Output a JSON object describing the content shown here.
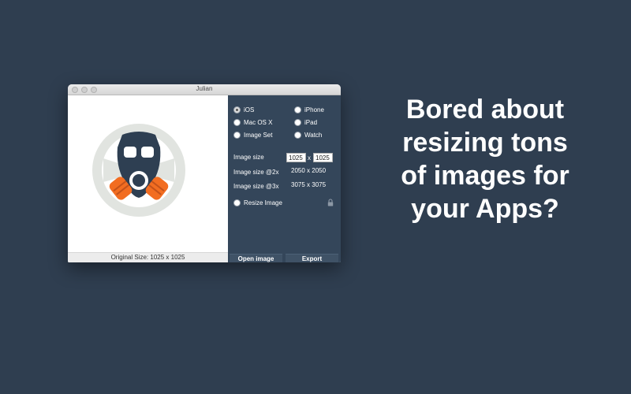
{
  "window": {
    "title": "Julian",
    "original_size_label": "Original Size: 1025 x 1025"
  },
  "platforms": {
    "ios": "iOS",
    "macosx": "Mac OS X",
    "imageset": "Image Set",
    "iphone": "iPhone",
    "ipad": "iPad",
    "watch": "Watch",
    "selected": "iOS"
  },
  "sizes": {
    "image_size_label": "Image size",
    "width_value": "1025",
    "separator": "x",
    "height_value": "1025",
    "size2x_label": "Image size @2x",
    "size2x_value": "2050 x 2050",
    "size3x_label": "Image size @3x",
    "size3x_value": "3075 x 3075"
  },
  "options": {
    "resize_label": "Resize Image"
  },
  "actions": {
    "open_label": "Open image",
    "export_label": "Export"
  },
  "headline": {
    "line1": "Bored about",
    "line2": "resizing tons",
    "line3": "of images for",
    "line4": "your Apps?"
  },
  "colors": {
    "background": "#2f3e50",
    "panel": "#34465a",
    "mask": "#2e3f52",
    "filter": "#f26d21",
    "ring": "#e1e4e0"
  },
  "icons": {
    "preview": "gas-mask-icon",
    "lock": "lock-icon"
  }
}
